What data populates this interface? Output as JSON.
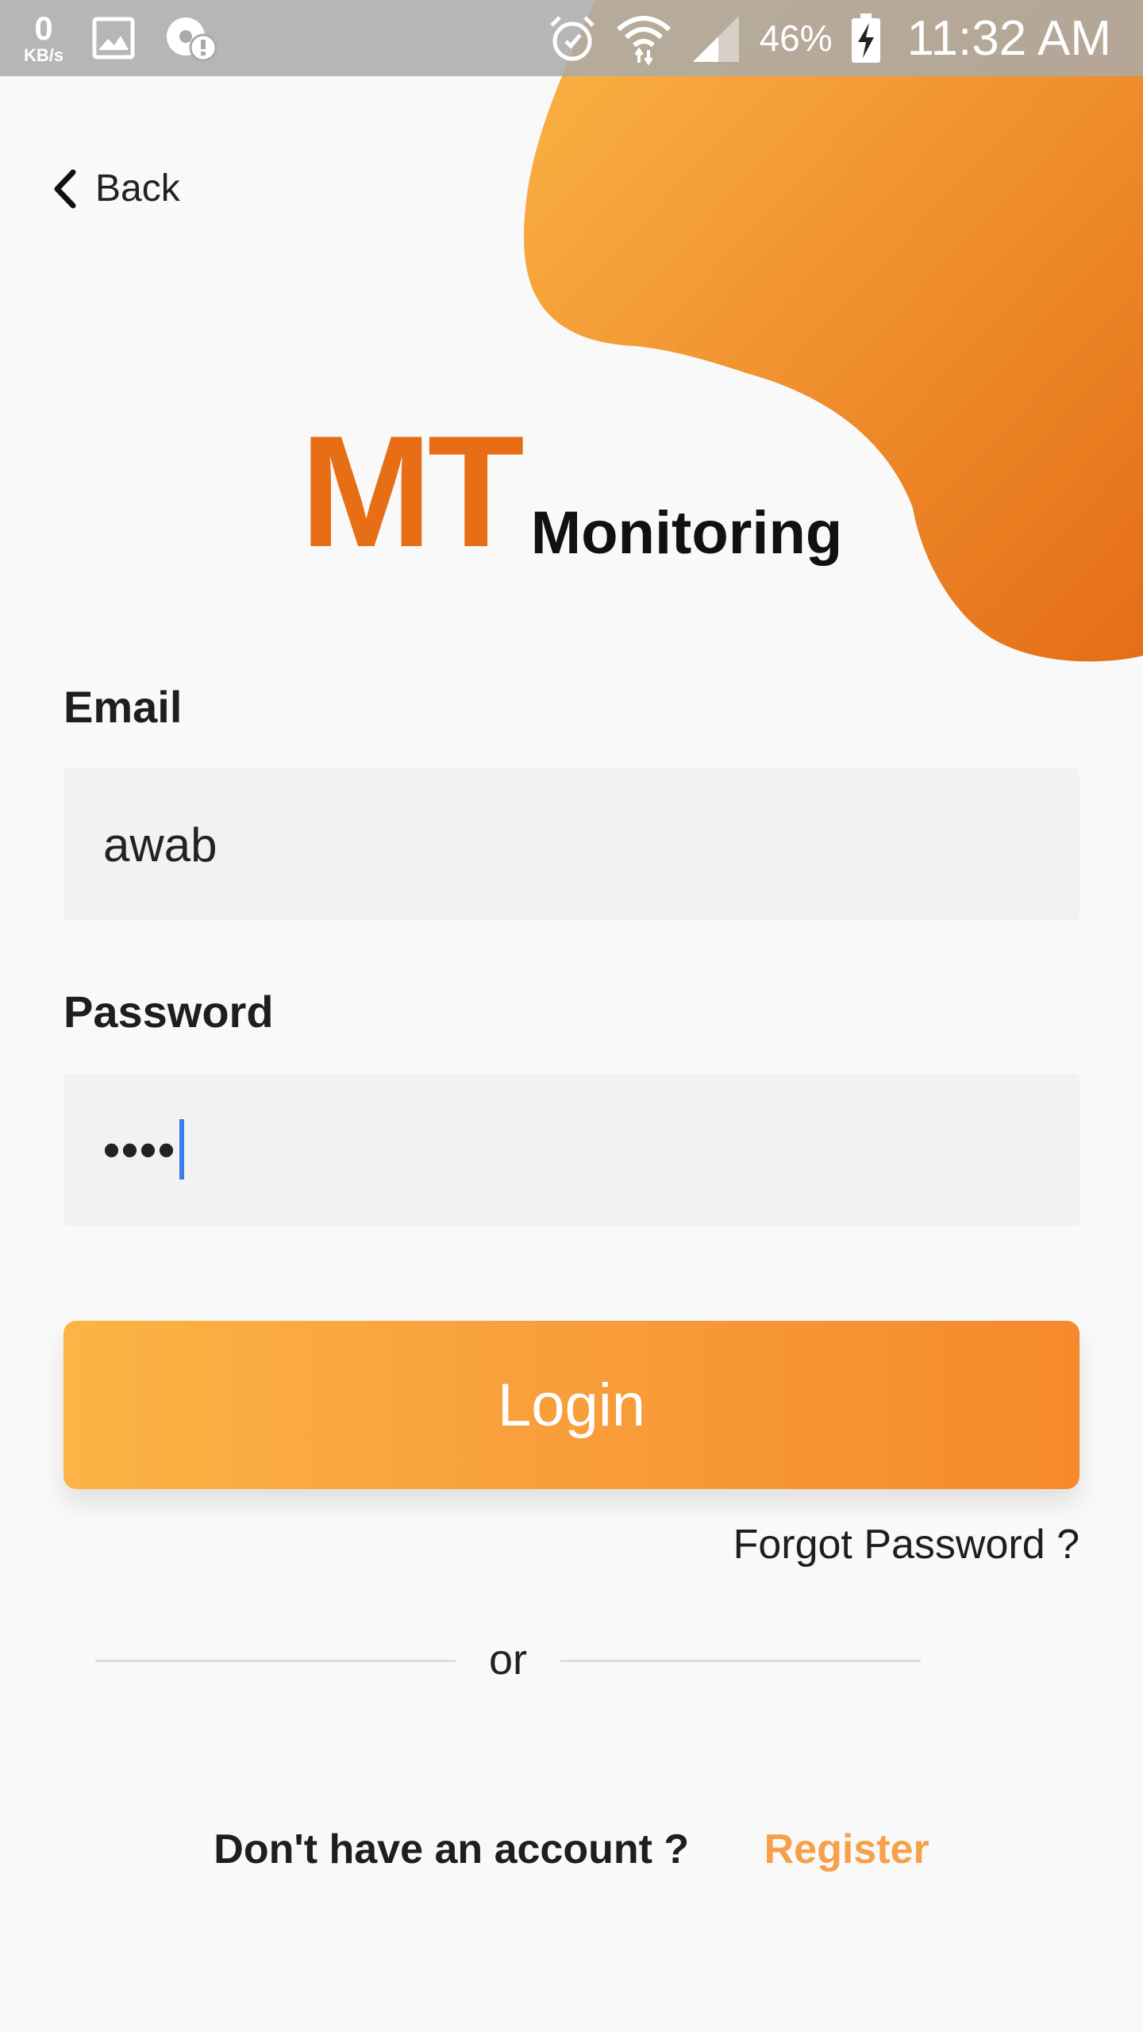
{
  "status_bar": {
    "speed_value": "0",
    "speed_unit": "KB/s",
    "battery_percent": "46%",
    "time": "11:32 AM",
    "icons": [
      "gallery-icon",
      "notification-alert-icon",
      "alarm-icon",
      "wifi-icon",
      "signal-icon",
      "battery-charging-icon"
    ]
  },
  "nav": {
    "back_label": "Back"
  },
  "logo": {
    "mark": "MT",
    "name": "Monitoring"
  },
  "form": {
    "email_label": "Email",
    "email_value": "awab",
    "password_label": "Password",
    "password_masked": "••••",
    "login_label": "Login",
    "forgot_label": "Forgot Password ?"
  },
  "divider": {
    "text": "or"
  },
  "footer": {
    "no_account_text": "Don't have an account ?",
    "register_label": "Register"
  },
  "colors": {
    "brand_orange": "#e86e16",
    "button_start": "#fbb445",
    "button_end": "#f6892c",
    "register_link": "#f6a04a",
    "caret": "#3d7bea"
  }
}
